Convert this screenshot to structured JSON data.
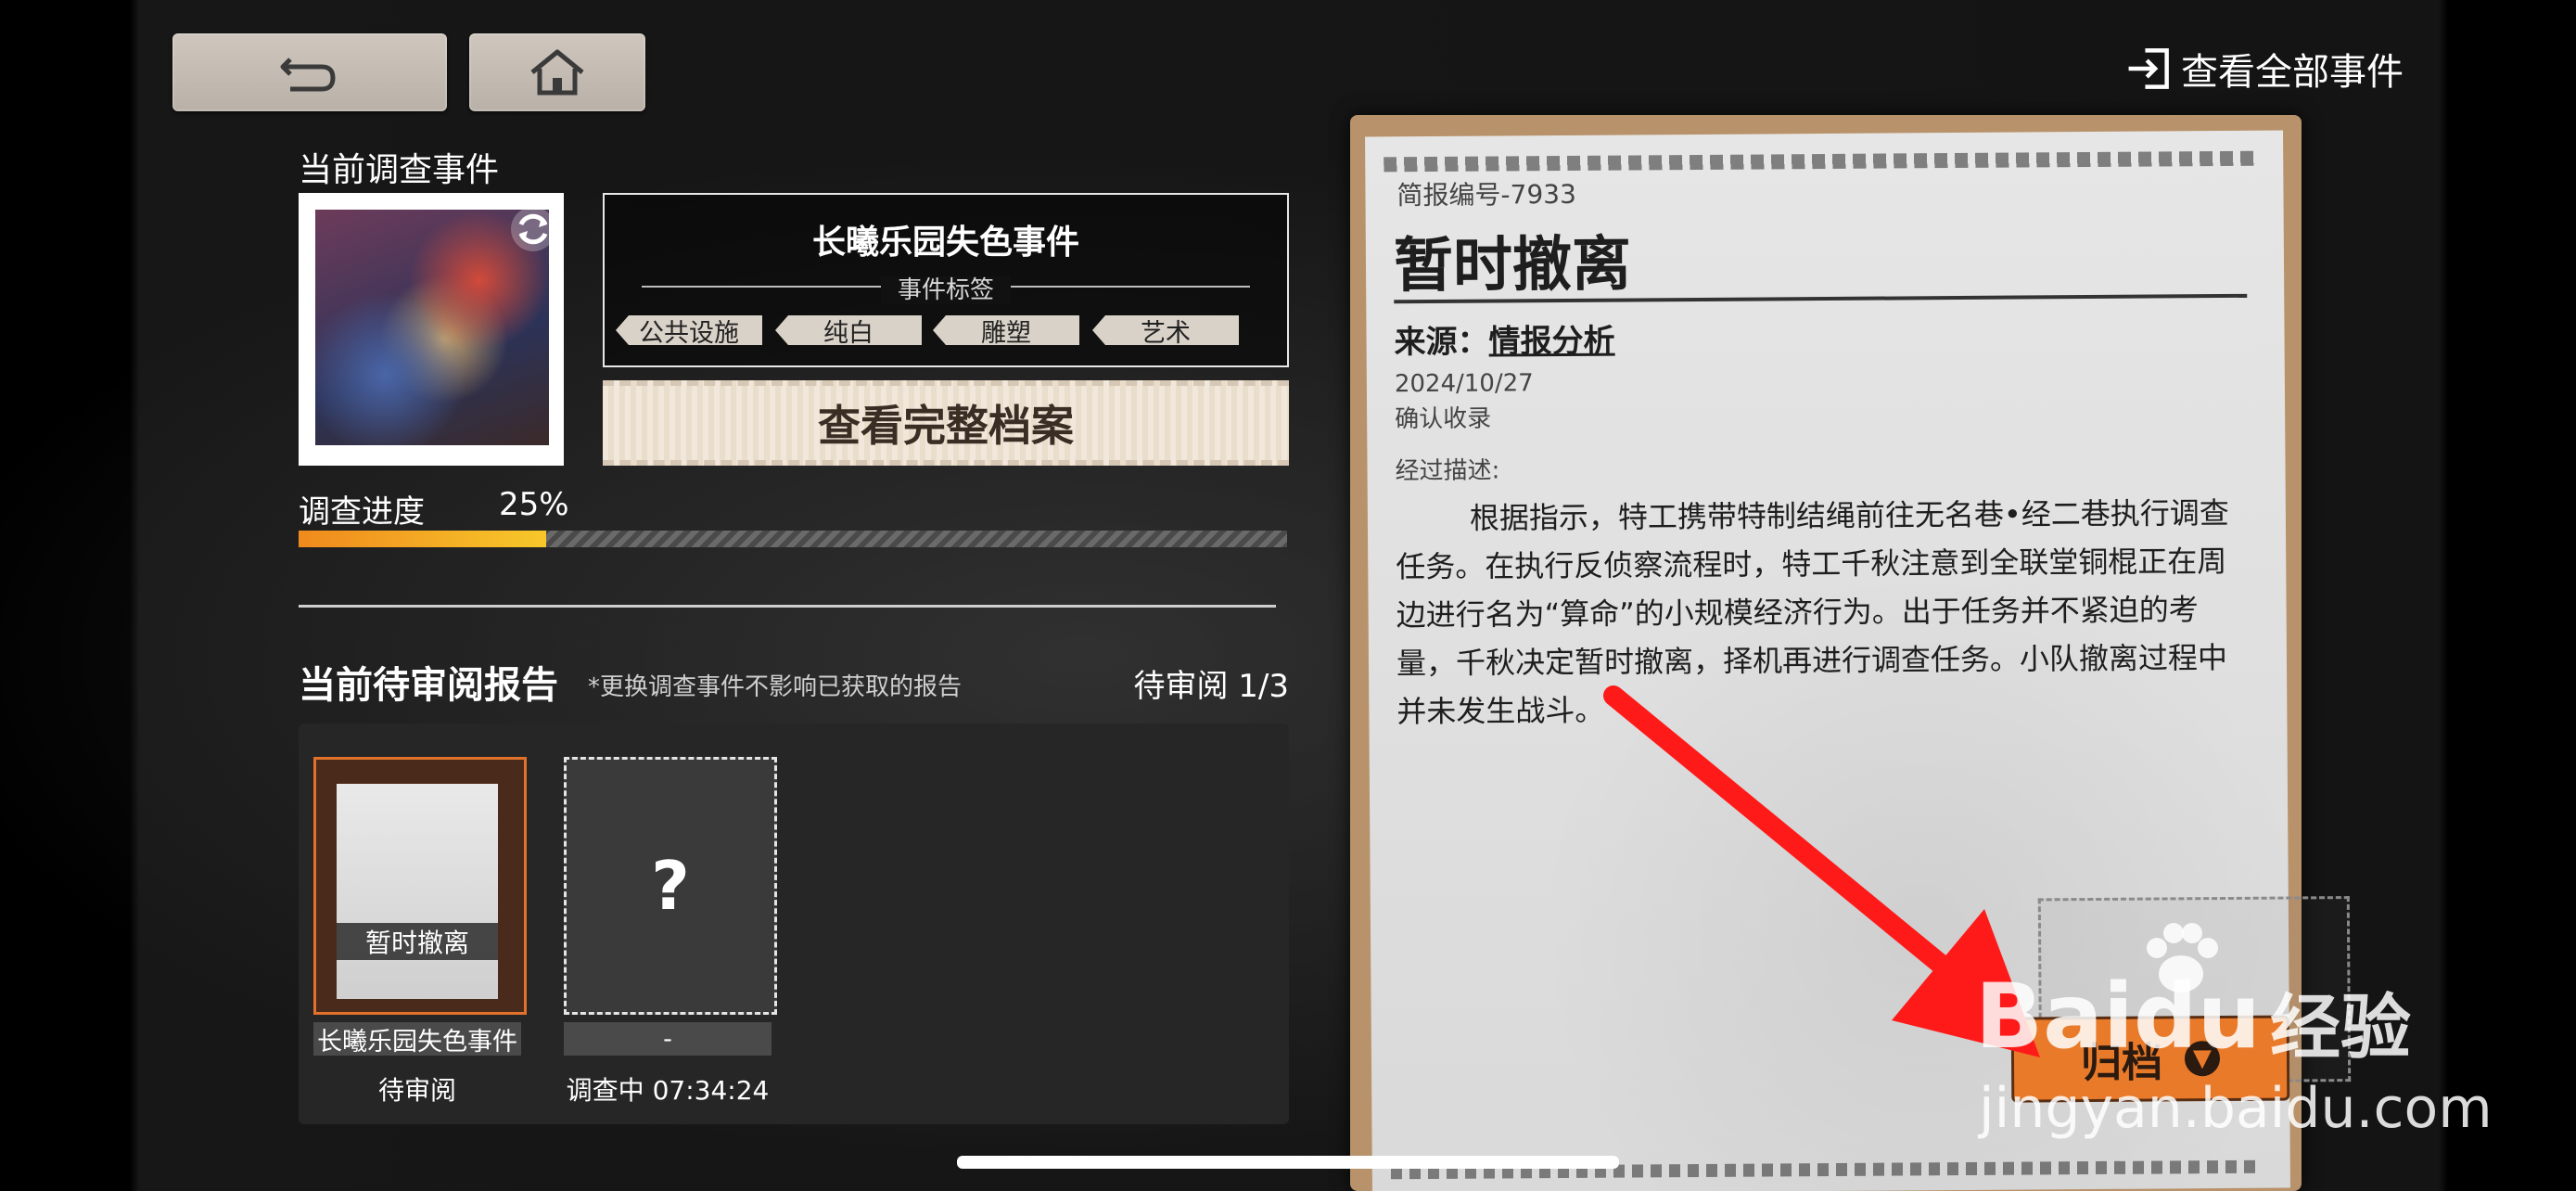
{
  "top_bar": {
    "view_all_label": "查看全部事件"
  },
  "current_event": {
    "section_title": "当前调查事件",
    "event_name": "长曦乐园失色事件",
    "tags_label": "事件标签",
    "tags": [
      "公共设施",
      "纯白",
      "雕塑",
      "艺术"
    ],
    "archive_button_label": "查看完整档案",
    "progress_label": "调查进度",
    "progress_value": "25%",
    "progress_fraction": 0.25
  },
  "reports": {
    "section_title": "当前待审阅报告",
    "note": "*更换调查事件不影响已获取的报告",
    "pending_count": "待审阅 1/3",
    "cards": [
      {
        "title": "暂时撤离",
        "event": "长曦乐园失色事件",
        "status": "待审阅"
      },
      {
        "placeholder": "?",
        "event": "-",
        "status": "调查中 07:34:24"
      }
    ]
  },
  "document": {
    "report_number": "简报编号-7933",
    "title": "暂时撤离",
    "source_label": "来源：",
    "source_value": "情报分析",
    "date": "2024/10/27",
    "received": "确认收录",
    "desc_label": "经过描述:",
    "body": "根据指示，特工携带特制结绳前往无名巷•经二巷执行调查任务。在执行反侦察流程时，特工千秋注意到全联堂铜棍正在周边进行名为“算命”的小规模经济行为。出于任务并不紧迫的考量，千秋决定暂时撤离，择机再进行调查任务。小队撤离过程中并未发生战斗。",
    "file_button_label": "归档"
  },
  "watermark": {
    "brand": "Baidu",
    "suffix": "经验",
    "url": "jingyan.baidu.com"
  },
  "colors": {
    "accent_orange": "#e97a2a",
    "progress_start": "#f08a1d",
    "progress_end": "#f7c82a",
    "annotation_arrow": "#ff1a1a"
  },
  "icons": [
    "back-arrow-icon",
    "home-icon",
    "exit-icon",
    "refresh-icon",
    "chevron-down-icon",
    "paw-icon"
  ]
}
